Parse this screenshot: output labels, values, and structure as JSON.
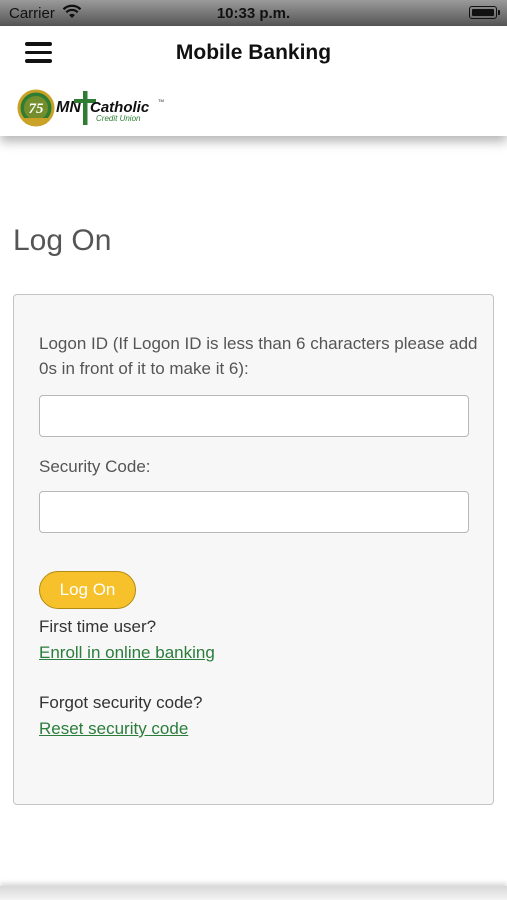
{
  "status_bar": {
    "carrier": "Carrier",
    "time": "10:33 p.m."
  },
  "header": {
    "title": "Mobile Banking"
  },
  "logo": {
    "anniversary": "75",
    "brand_left": "MN",
    "brand_right": "Catholic",
    "subtitle": "Credit Union",
    "trademark": "TM",
    "colors": {
      "green": "#2e7d32",
      "gold": "#c9a227"
    }
  },
  "page": {
    "title": "Log On"
  },
  "form": {
    "logon_label": "Logon ID (If Logon ID is less than 6 characters please add 0s in front of it to make it 6):",
    "logon_value": "",
    "security_label": "Security Code:",
    "security_value": "",
    "submit_label": "Log On",
    "first_time_prompt": "First time user?",
    "enroll_link": "Enroll in online banking",
    "forgot_prompt": "Forgot security code?",
    "reset_link": "Reset security code"
  },
  "colors": {
    "accent_button": "#f6c12a",
    "link": "#2a7d3b"
  }
}
